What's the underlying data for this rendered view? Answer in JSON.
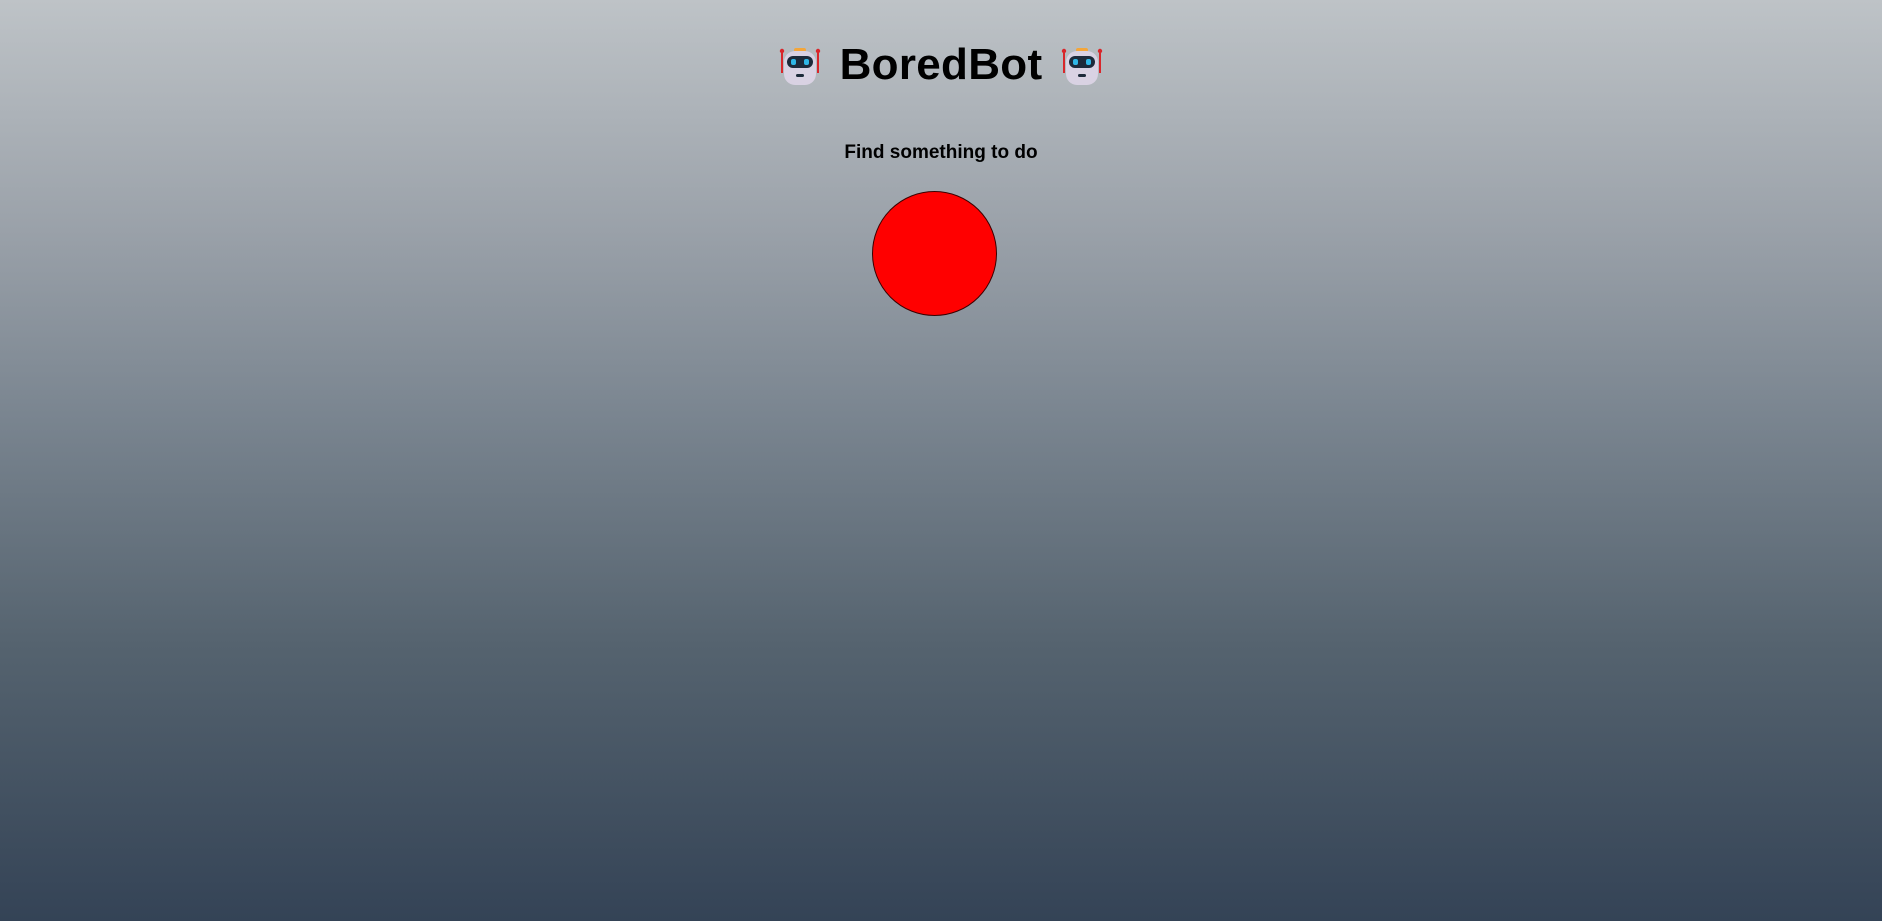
{
  "header": {
    "title": "BoredBot",
    "left_icon": "robot-face-icon",
    "right_icon": "robot-face-icon"
  },
  "main": {
    "subtitle": "Find something to do",
    "action_button_color": "#ff0000"
  },
  "colors": {
    "background_top": "#bec3c7",
    "background_bottom": "#344356",
    "accent": "#ff0000"
  }
}
